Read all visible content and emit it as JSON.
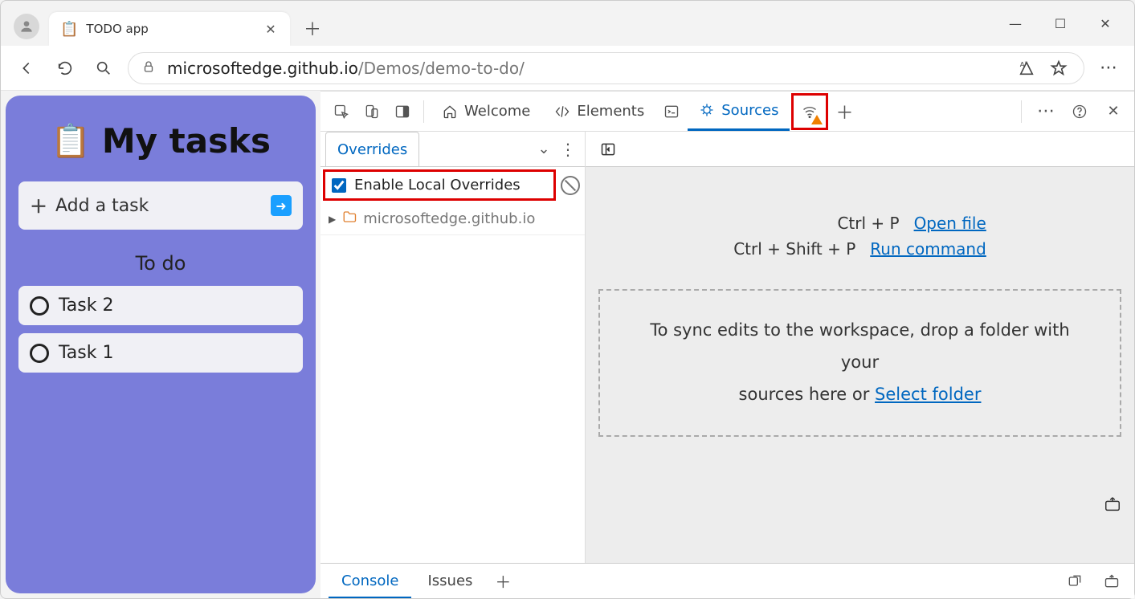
{
  "browser": {
    "tab_title": "TODO app",
    "url_host": "microsoftedge.github.io",
    "url_path": "/Demos/demo-to-do/"
  },
  "app": {
    "title": "My tasks",
    "add_placeholder": "Add a task",
    "section_label": "To do",
    "tasks": [
      "Task 2",
      "Task 1"
    ]
  },
  "devtools": {
    "tabs": {
      "welcome": "Welcome",
      "elements": "Elements",
      "sources": "Sources"
    },
    "sidebar_tab": "Overrides",
    "enable_label": "Enable Local Overrides",
    "tree_host": "microsoftedge.github.io",
    "hints": {
      "open_shortcut": "Ctrl + P",
      "open_link": "Open file",
      "run_shortcut": "Ctrl + Shift + P",
      "run_link": "Run command"
    },
    "drop_text_a": "To sync edits to the workspace, drop a folder with your",
    "drop_text_b": "sources here or ",
    "drop_link": "Select folder",
    "drawer": {
      "console": "Console",
      "issues": "Issues"
    }
  }
}
